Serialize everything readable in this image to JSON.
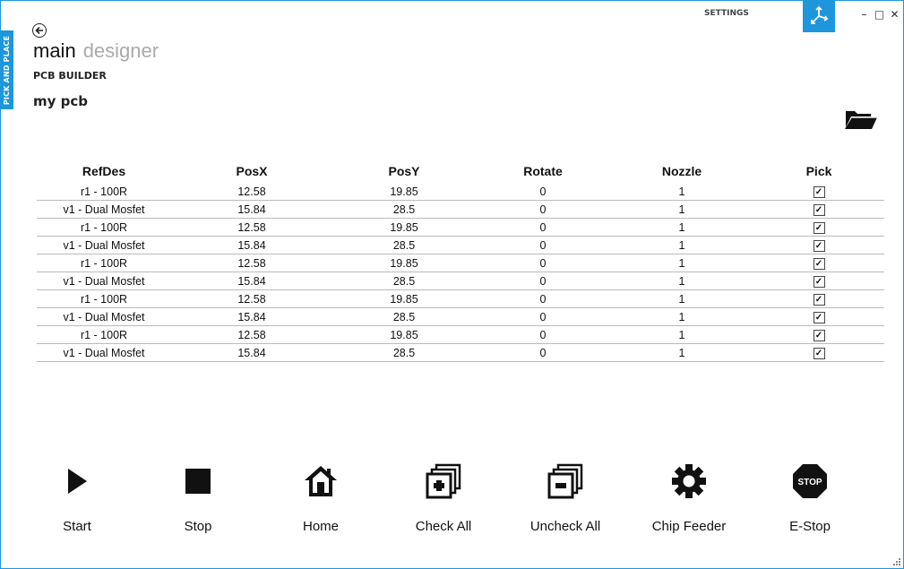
{
  "window": {
    "side_tab": "PICK AND PLACE",
    "settings": "SETTINGS",
    "controls": [
      "–",
      "□",
      "✕"
    ]
  },
  "nav": {
    "active": "main",
    "inactive": "designer",
    "subtitle": "PCB BUILDER",
    "pcb_name": "my pcb"
  },
  "table": {
    "headers": [
      "RefDes",
      "PosX",
      "PosY",
      "Rotate",
      "Nozzle",
      "Pick"
    ],
    "rows": [
      {
        "refdes": "r1 - 100R",
        "posx": "12.58",
        "posy": "19.85",
        "rotate": "0",
        "nozzle": "1",
        "pick": true
      },
      {
        "refdes": "v1 - Dual Mosfet",
        "posx": "15.84",
        "posy": "28.5",
        "rotate": "0",
        "nozzle": "1",
        "pick": true
      },
      {
        "refdes": "r1 - 100R",
        "posx": "12.58",
        "posy": "19.85",
        "rotate": "0",
        "nozzle": "1",
        "pick": true
      },
      {
        "refdes": "v1 - Dual Mosfet",
        "posx": "15.84",
        "posy": "28.5",
        "rotate": "0",
        "nozzle": "1",
        "pick": true
      },
      {
        "refdes": "r1 - 100R",
        "posx": "12.58",
        "posy": "19.85",
        "rotate": "0",
        "nozzle": "1",
        "pick": true
      },
      {
        "refdes": "v1 - Dual Mosfet",
        "posx": "15.84",
        "posy": "28.5",
        "rotate": "0",
        "nozzle": "1",
        "pick": true
      },
      {
        "refdes": "r1 - 100R",
        "posx": "12.58",
        "posy": "19.85",
        "rotate": "0",
        "nozzle": "1",
        "pick": true
      },
      {
        "refdes": "v1 - Dual Mosfet",
        "posx": "15.84",
        "posy": "28.5",
        "rotate": "0",
        "nozzle": "1",
        "pick": true
      },
      {
        "refdes": "r1 - 100R",
        "posx": "12.58",
        "posy": "19.85",
        "rotate": "0",
        "nozzle": "1",
        "pick": true
      },
      {
        "refdes": "v1 - Dual Mosfet",
        "posx": "15.84",
        "posy": "28.5",
        "rotate": "0",
        "nozzle": "1",
        "pick": true
      }
    ]
  },
  "toolbar": {
    "start": "Start",
    "stop": "Stop",
    "home": "Home",
    "check_all": "Check All",
    "uncheck_all": "Uncheck All",
    "chip_feeder": "Chip Feeder",
    "estop": "E-Stop",
    "estop_icon_text": "STOP"
  },
  "colors": {
    "accent": "#1e96dc"
  }
}
